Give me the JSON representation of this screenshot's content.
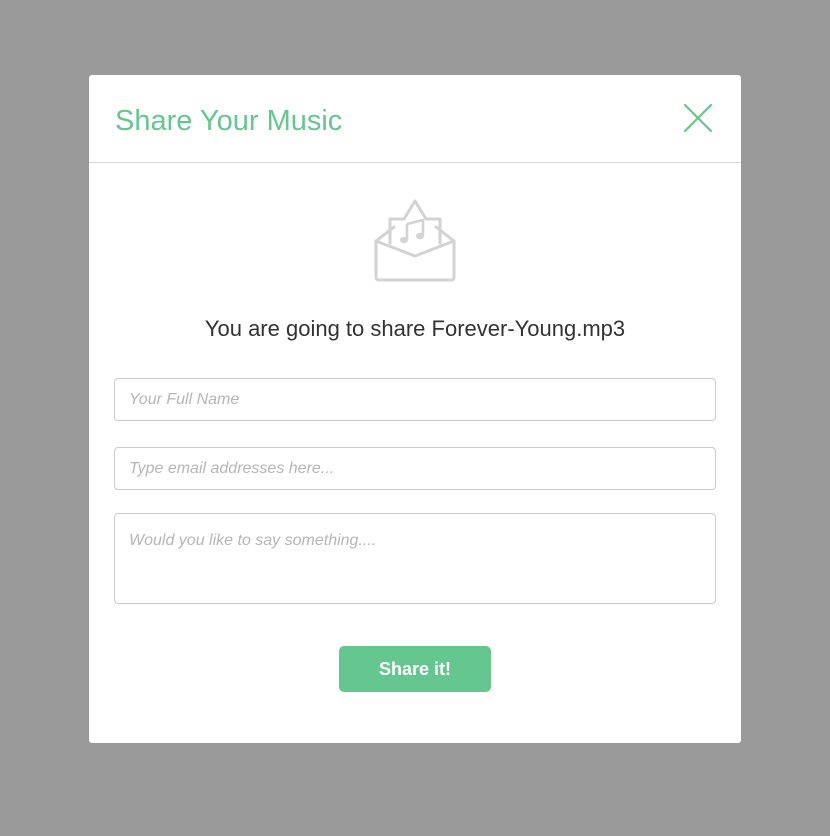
{
  "colors": {
    "accent": "#66c690",
    "overlay": "#9a9a9a",
    "icon_gray": "#d3d3d3",
    "text": "#333333",
    "placeholder": "#b6b6b6"
  },
  "modal": {
    "title": "Share Your Music",
    "close_icon": "close-icon",
    "envelope_icon": "envelope-music-icon",
    "message": "You are going to share Forever-Young.mp3",
    "form": {
      "name_placeholder": "Your Full Name",
      "name_value": "",
      "email_placeholder": "Type email addresses here...",
      "email_value": "",
      "message_placeholder": "Would you like to say something....",
      "message_value": ""
    },
    "share_button_label": "Share it!"
  }
}
